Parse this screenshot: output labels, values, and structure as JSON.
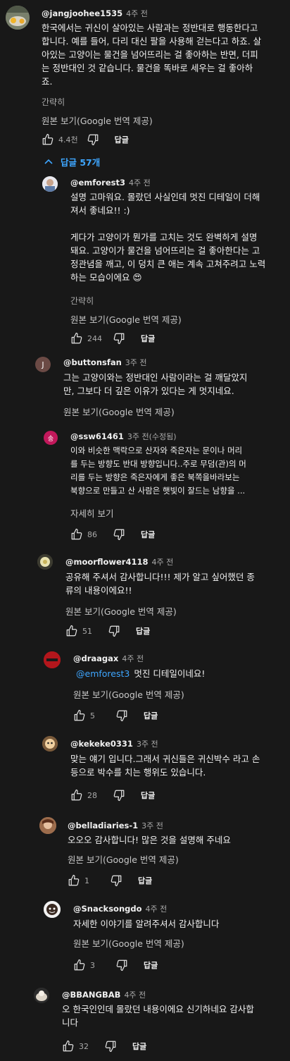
{
  "colors": {
    "bg": "#181818",
    "text": "#f1f1f1",
    "secondary": "#aaaaaa",
    "link_blue": "#3ea6ff"
  },
  "top_comment": {
    "author": "@jangjoohee1535",
    "time": "4주 전",
    "lines": [
      "한국에서는 귀신이 살아있는 사람과는 정반대로 행동한다고",
      "합니다. 예를 들어, 다리 대신 팔을 사용해 걷는다고 하죠. 살",
      "아있는 고양이는 물건을 넘어뜨리는 걸 좋아하는 반면, 더피",
      "는 정반대인 것 같습니다. 물건을 똑바로 세우는 걸 좋아하",
      "죠."
    ],
    "collapse_label": "간략히",
    "translate_label": "원본 보기(Google 번역 제공)",
    "likes": "4.4천",
    "reply_label": "답글"
  },
  "replies_toggle": {
    "label": "답글 57개",
    "icon": "chevron-up-icon"
  },
  "replies": [
    {
      "author": "@emforest3",
      "time": "4주 전",
      "paragraphs": [
        [
          "설명 고마워요. 몰랐던 사실인데 멋진 디테일이 더해",
          "져서 좋네요!! :)"
        ],
        [
          "게다가 고양이가 뭔가를 고치는 것도 완벽하게 설명",
          "돼요. 고양이가 물건을 넘어뜨리는 걸 좋아한다는 고",
          "정관념을 깨고, 이 덩치 큰 애는 계속 고쳐주려고 노력",
          "하는 모습이에요 😍"
        ]
      ],
      "extra_label": "간략히",
      "translate_label": "원본 보기(Google 번역 제공)",
      "likes": "244",
      "reply_label": "답글"
    },
    {
      "author": "@buttonsfan",
      "time": "3주 전",
      "avatar_letter": "J",
      "paragraphs": [
        [
          "그는 고양이와는 정반대인 사람이라는 걸 깨달았지",
          "만, 그보다 더 깊은 이유가 있다는 게 멋지네요."
        ]
      ],
      "translate_label": "원본 보기(Google 번역 제공)"
    },
    {
      "author": "@ssw61461",
      "time": "3주 전(수정됨)",
      "avatar_letter": "송",
      "paragraphs": [
        [
          "이와 비슷한 맥락으로 산자와 죽은자는 문이나 머리",
          "를 두는 방향도 반대 방향입니다..주로 무덤(관)의 머",
          "리를 두는 방향은 죽은자에게 좋은 북쪽을바라보는",
          "북향으로 만들고 산 사람은 햇빛이 잘드는 남향을 ..."
        ]
      ],
      "extra_label": "자세히 보기",
      "likes": "86",
      "reply_label": "답글"
    },
    {
      "author": "@moorflower4118",
      "time": "4주 전",
      "paragraphs": [
        [
          "공유해 주셔서 감사합니다!!! 제가 알고 싶어했던 종",
          "류의 내용이에요!!"
        ]
      ],
      "translate_label": "원본 보기(Google 번역 제공)",
      "likes": "51",
      "reply_label": "답글"
    },
    {
      "author": "@draagax",
      "time": "4주 전",
      "mention": "@emforest3",
      "paragraphs": [
        [
          "멋진 디테일이네요!"
        ]
      ],
      "translate_label": "원본 보기(Google 번역 제공)",
      "likes": "5",
      "reply_label": "답글"
    },
    {
      "author": "@kekeke0331",
      "time": "3주 전",
      "paragraphs": [
        [
          "맞는 얘기 입니다.그래서 귀신들은 귀신박수 라고 손",
          "등으로 박수를 치는 행위도 있습니다."
        ]
      ],
      "likes": "28",
      "reply_label": "답글"
    },
    {
      "author": "@belladiaries-1",
      "time": "3주 전",
      "paragraphs": [
        [
          "오오오 감사합니다! 많은 것을 설명해 주네요"
        ]
      ],
      "translate_label": "원본 보기(Google 번역 제공)",
      "likes": "1",
      "reply_label": "답글"
    },
    {
      "author": "@Snacksongdo",
      "time": "4주 전",
      "paragraphs": [
        [
          "자세한 이야기를 알려주셔서 감사합니다"
        ]
      ],
      "translate_label": "원본 보기(Google 번역 제공)",
      "likes": "3",
      "reply_label": "답글"
    },
    {
      "author": "@BBANGBAB",
      "time": "4주 전",
      "paragraphs": [
        [
          "오 한국인인데 몰랐던 내용이에요 신기하네요 감사합",
          "니다"
        ]
      ],
      "likes": "32",
      "reply_label": "답글"
    }
  ]
}
